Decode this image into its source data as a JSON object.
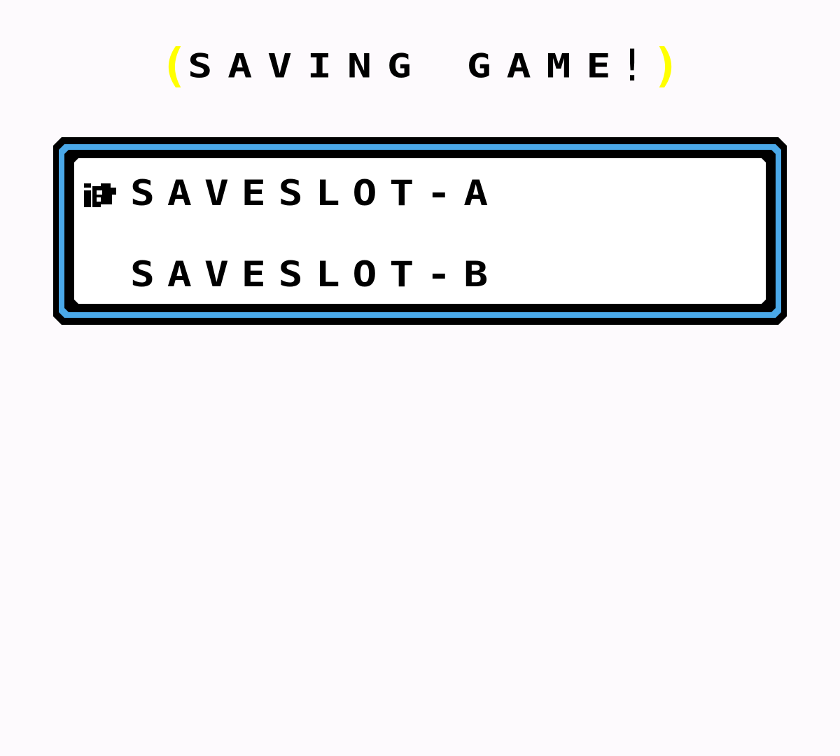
{
  "title": {
    "left_bracket": "(",
    "text": "SAVING GAME",
    "exclaim": "!",
    "right_bracket": ")",
    "bracket_color": "#ffff00"
  },
  "menu": {
    "items": [
      {
        "label": "SAVESLOT-A",
        "selected": true
      },
      {
        "label": "SAVESLOT-B",
        "selected": false
      }
    ],
    "cursor_icon": "hand-pointer-icon",
    "border_color": "#000000",
    "accent_color": "#4aa8e8"
  }
}
